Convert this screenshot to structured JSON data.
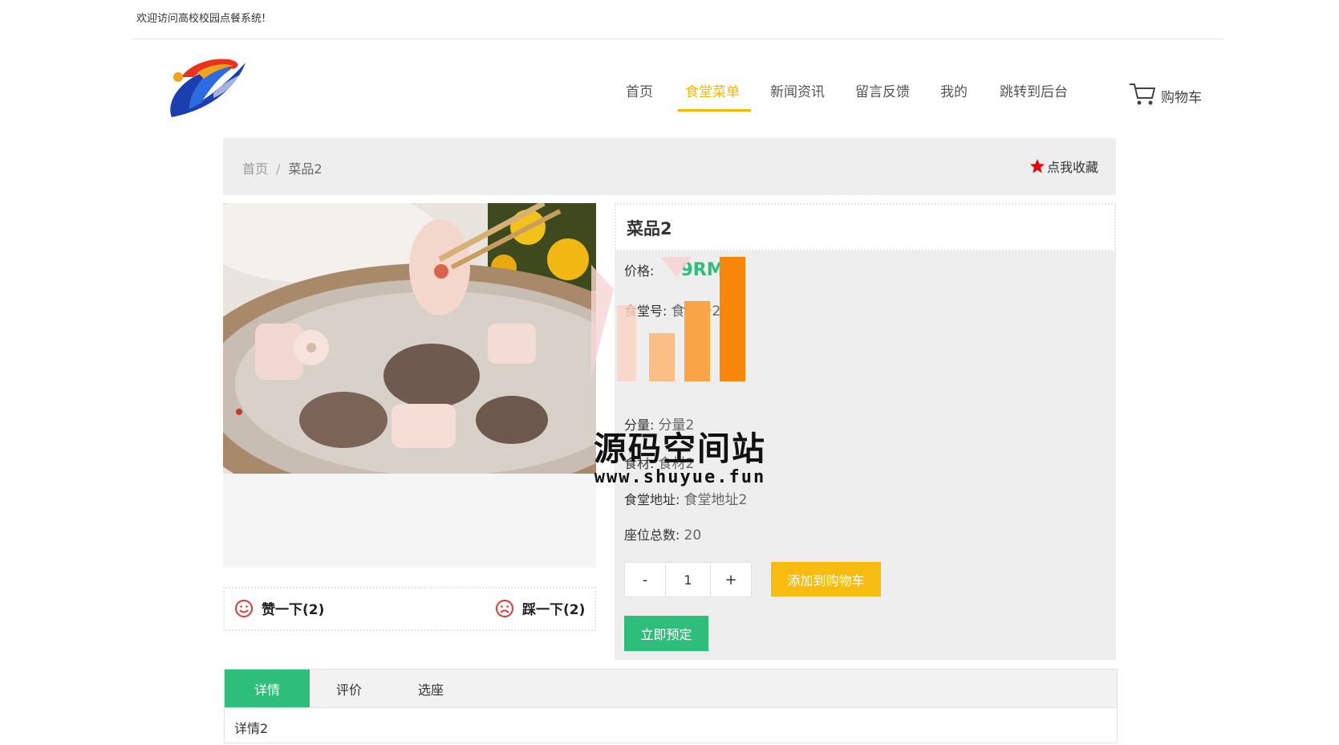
{
  "topbar": {
    "welcome": "欢迎访问高校校园点餐系统!"
  },
  "nav": {
    "items": [
      "首页",
      "食堂菜单",
      "新闻资讯",
      "留言反馈",
      "我的",
      "跳转到后台"
    ],
    "active_index": 1,
    "cart_label": "购物车"
  },
  "breadcrumb": {
    "home": "首页",
    "separator": "/",
    "current": "菜品2"
  },
  "favorite": {
    "label": "点我收藏"
  },
  "vote": {
    "like_label": "赞一下(2)",
    "dislike_label": "踩一下(2)"
  },
  "product": {
    "name": "菜品2",
    "price_label": "价格:",
    "price_value": "9RMB",
    "canteen_no_label": "食堂号:",
    "canteen_no_value": "食堂号2",
    "portion_label": "分量:",
    "portion_value": "分量2",
    "ingredients_label": "食材:",
    "ingredients_value": "食材2",
    "address_label": "食堂地址:",
    "address_value": "食堂地址2",
    "seats_label": "座位总数:",
    "seats_value": "20"
  },
  "quantity": {
    "minus": "-",
    "value": "1",
    "plus": "+"
  },
  "buttons": {
    "add_to_cart": "添加到购物车",
    "reserve": "立即预定"
  },
  "tabs": {
    "items": [
      "详情",
      "评价",
      "选座"
    ],
    "active_index": 0,
    "content": "详情2"
  },
  "watermark": {
    "title": "源码空间站",
    "url": "www.shuyue.fun"
  },
  "colors": {
    "accent_yellow": "#f5b800",
    "accent_green": "#2fbd7c",
    "panel_grey": "#eeeeee"
  }
}
